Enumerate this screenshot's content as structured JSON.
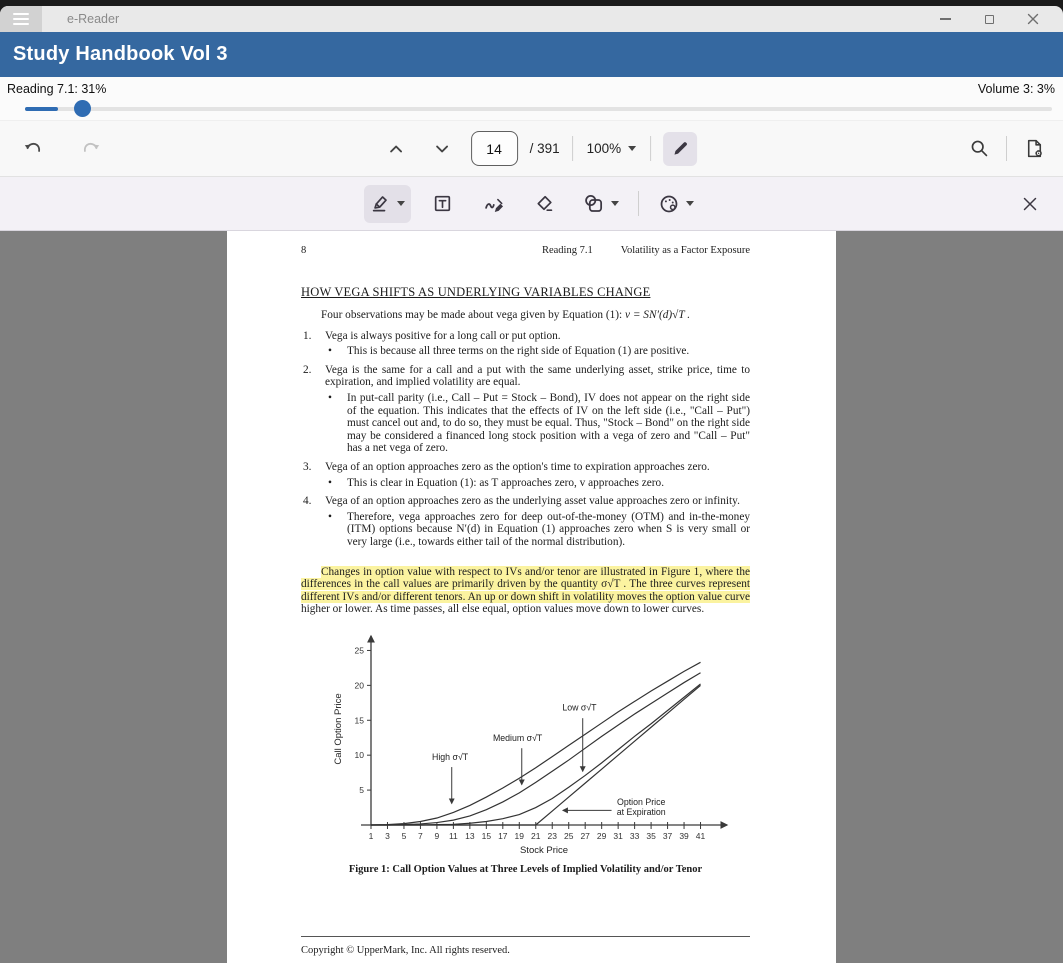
{
  "window": {
    "title": "e-Reader"
  },
  "header": {
    "title": "Study Handbook Vol 3",
    "color": "#3568a0"
  },
  "progress": {
    "left_label": "Reading 7.1: 31%",
    "right_label": "Volume 3: 3%",
    "slider_percent": 3
  },
  "toolbar": {
    "page_number": "14",
    "page_total": "/ 391",
    "zoom_level": "100%"
  },
  "doc": {
    "page_header": {
      "page_num": "8",
      "reading": "Reading 7.1",
      "title": "Volatility as a Factor Exposure"
    },
    "heading": "HOW VEGA SHIFTS AS UNDERLYING VARIABLES CHANGE",
    "intro": {
      "text": "Four observations may be made about vega given by Equation (1): ",
      "formula": "v = SN′(d)√T ."
    },
    "list": [
      {
        "num": "1.",
        "text": "Vega is always positive for a long call or put option.",
        "bullets": [
          "This is because all three terms on the right side of Equation (1) are positive."
        ]
      },
      {
        "num": "2.",
        "text": "Vega is the same for a call and a put with the same underlying asset, strike price, time to expiration, and implied volatility are equal.",
        "bullets": [
          "In put-call parity (i.e., Call – Put = Stock – Bond), IV does not appear on the right side of the equation. This indicates that the effects of IV on the left side (i.e., \"Call – Put\") must cancel out and, to do so, they must be equal. Thus, \"Stock – Bond\" on the right side may be considered a financed long stock position with a vega of zero and \"Call – Put\" has a net vega of zero."
        ]
      },
      {
        "num": "3.",
        "text": "Vega of an option approaches zero as the option's time to expiration approaches zero.",
        "bullets": [
          "This is clear in Equation (1): as T approaches zero, v approaches zero."
        ]
      },
      {
        "num": "4.",
        "text": "Vega of an option approaches zero as the underlying asset value approaches zero or infinity.",
        "bullets": [
          "Therefore, vega approaches zero for deep out-of-the-money (OTM) and in-the-money (ITM) options because N′(d) in Equation (1) approaches zero when S is very small or very large (i.e., towards either tail of the normal distribution)."
        ]
      }
    ],
    "highlight_para": {
      "highlighted": "Changes in option value with respect to IVs and/or tenor are illustrated in Figure 1, where the differences in the call values are primarily driven by the quantity σ√T . The three curves represent different IVs and/or different tenors. An up or down shift in volatility moves the option value curve",
      "plain": " higher or lower. As time passes, all else equal, option values move down to lower curves."
    },
    "figure_caption": "Figure 1: Call Option Values at Three Levels of Implied Volatility and/or Tenor",
    "footer": "Copyright © UpperMark, Inc. All rights reserved."
  },
  "chart_data": {
    "type": "line",
    "title": "Figure 1: Call Option Values at Three Levels of Implied Volatility and/or Tenor",
    "xlabel": "Stock Price",
    "ylabel": "Call Option Price",
    "xlim": [
      1,
      43
    ],
    "ylim": [
      0,
      27.5
    ],
    "xticks": [
      1,
      3,
      5,
      7,
      9,
      11,
      13,
      15,
      17,
      19,
      21,
      23,
      25,
      27,
      29,
      31,
      33,
      35,
      37,
      39,
      41
    ],
    "yticks": [
      5,
      10,
      15,
      20,
      25
    ],
    "grid": false,
    "legend": "inline annotations",
    "x": [
      1,
      3,
      5,
      7,
      9,
      11,
      13,
      15,
      17,
      19,
      21,
      23,
      25,
      27,
      29,
      31,
      33,
      35,
      37,
      39,
      41
    ],
    "series": [
      {
        "name": "High σ√T",
        "values": [
          0,
          0.05,
          0.2,
          0.5,
          1.0,
          1.8,
          2.8,
          4.0,
          5.3,
          6.7,
          8.2,
          9.8,
          11.4,
          13.0,
          14.6,
          16.2,
          17.7,
          19.2,
          20.6,
          22.0,
          23.3
        ]
      },
      {
        "name": "Medium σ√T",
        "values": [
          0,
          0,
          0.05,
          0.15,
          0.35,
          0.7,
          1.3,
          2.2,
          3.3,
          4.6,
          6.1,
          7.7,
          9.3,
          11.0,
          12.7,
          14.3,
          15.9,
          17.4,
          18.9,
          20.4,
          21.8
        ]
      },
      {
        "name": "Low σ√T",
        "values": [
          0,
          0,
          0,
          0,
          0.05,
          0.1,
          0.25,
          0.5,
          0.9,
          1.5,
          2.5,
          3.8,
          5.4,
          7.1,
          8.9,
          10.8,
          12.7,
          14.5,
          16.4,
          18.3,
          20.2
        ]
      },
      {
        "name": "Option Price at Expiration",
        "values": [
          0,
          0,
          0,
          0,
          0,
          0,
          0,
          0,
          0,
          0,
          0,
          2,
          4,
          6,
          8,
          10,
          12,
          14,
          16,
          18,
          20
        ]
      }
    ],
    "annotations": [
      {
        "text": "High σ√T",
        "x": 10.6,
        "y": 9.3,
        "arrow": {
          "x1": 10.8,
          "y1": 8.3,
          "x2": 10.8,
          "y2": 3.1
        }
      },
      {
        "text": "Medium  σ√T",
        "x": 18.8,
        "y": 12.0,
        "arrow": {
          "x1": 19.3,
          "y1": 11.0,
          "x2": 19.3,
          "y2": 5.8
        }
      },
      {
        "text": "Low σ√T",
        "x": 26.3,
        "y": 16.4,
        "arrow": {
          "x1": 26.7,
          "y1": 15.3,
          "x2": 26.7,
          "y2": 7.7
        }
      },
      {
        "text": "Option Price\nat Expiration",
        "x": 33.8,
        "y": 2.9,
        "arrow": {
          "x1": 30.2,
          "y1": 2.1,
          "x2": 24.3,
          "y2": 2.1
        }
      }
    ]
  }
}
